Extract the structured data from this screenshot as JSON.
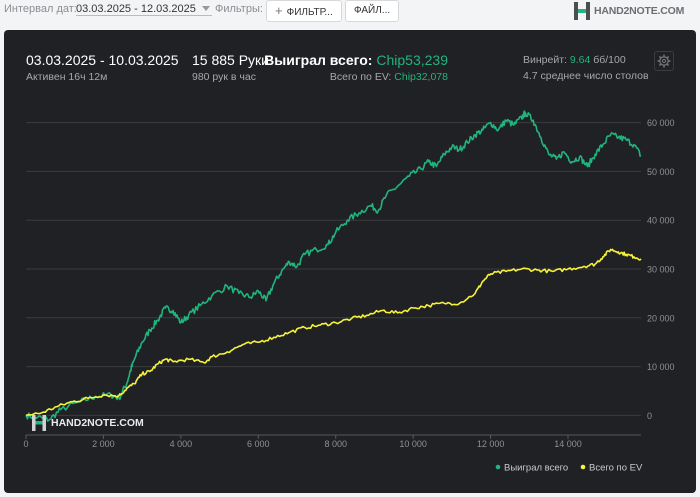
{
  "toolbar": {
    "interval_label": "Интервал дат:",
    "interval_value": "03.03.2025 - 12.03.2025",
    "filters_label": "Фильтры:",
    "filters_button": "ФИЛЬТР...",
    "files_button": "ФАЙЛ...",
    "logo_text": "HAND2NOTE.COM",
    "icons": {
      "add": "plus-icon",
      "dropdown": "chevron-down-icon",
      "settings": "gear-icon"
    }
  },
  "summary": {
    "date_range": "03.03.2025 - 10.03.2025",
    "active": "Активен 16ч 12м",
    "hands": "15 885 Руки",
    "hands_per_hour": "980 рук в час",
    "won_label": "Выиграл всего:",
    "won_value": "Chip53,239",
    "ev_label": "Всего по EV:",
    "ev_value": "Chip32,078",
    "winrate_label": "Винрейт:",
    "winrate_value": "9.64",
    "winrate_unit": "бб/100",
    "tables": "4.7 среднее число столов"
  },
  "watermark": "HAND2NOTE.COM",
  "colors": {
    "won": "#21b47d",
    "ev": "#f6f33a",
    "panel": "#202124",
    "grid": "#3a3c40"
  },
  "chart_data": {
    "type": "line",
    "xlim": [
      0,
      15885
    ],
    "ylim": [
      -3000,
      63000
    ],
    "x_ticks": [
      "0",
      "2 000",
      "4 000",
      "6 000",
      "8 000",
      "10 000",
      "12 000",
      "14 000"
    ],
    "y_ticks": [
      "0",
      "10 000",
      "20 000",
      "30 000",
      "40 000",
      "50 000",
      "60 000"
    ],
    "grid": true,
    "legend_position": "bottom-right",
    "series": [
      {
        "name": "Выиграл всего",
        "color": "#21b47d",
        "points": [
          [
            0,
            0
          ],
          [
            300,
            -400
          ],
          [
            600,
            -900
          ],
          [
            900,
            1200
          ],
          [
            1400,
            2800
          ],
          [
            1800,
            3900
          ],
          [
            2200,
            4200
          ],
          [
            2400,
            3500
          ],
          [
            2600,
            6500
          ],
          [
            2700,
            9200
          ],
          [
            2800,
            11500
          ],
          [
            3000,
            15000
          ],
          [
            3200,
            17500
          ],
          [
            3400,
            19500
          ],
          [
            3600,
            22000
          ],
          [
            3800,
            21500
          ],
          [
            4000,
            19000
          ],
          [
            4200,
            20500
          ],
          [
            4500,
            22500
          ],
          [
            4800,
            24500
          ],
          [
            5200,
            26500
          ],
          [
            5500,
            25000
          ],
          [
            5800,
            24200
          ],
          [
            6000,
            25500
          ],
          [
            6200,
            23500
          ],
          [
            6400,
            27000
          ],
          [
            6600,
            29500
          ],
          [
            6800,
            31500
          ],
          [
            7000,
            30500
          ],
          [
            7200,
            33000
          ],
          [
            7500,
            34000
          ],
          [
            7800,
            35000
          ],
          [
            8000,
            37500
          ],
          [
            8300,
            40000
          ],
          [
            8600,
            41500
          ],
          [
            8900,
            43000
          ],
          [
            9100,
            42000
          ],
          [
            9300,
            45000
          ],
          [
            9600,
            47000
          ],
          [
            9900,
            49000
          ],
          [
            10200,
            50500
          ],
          [
            10400,
            52000
          ],
          [
            10600,
            51000
          ],
          [
            10800,
            53500
          ],
          [
            11000,
            55000
          ],
          [
            11200,
            54500
          ],
          [
            11400,
            56000
          ],
          [
            11600,
            57500
          ],
          [
            11800,
            58500
          ],
          [
            12000,
            60000
          ],
          [
            12200,
            58500
          ],
          [
            12400,
            60500
          ],
          [
            12600,
            59500
          ],
          [
            12800,
            61000
          ],
          [
            12900,
            62000
          ],
          [
            13100,
            60500
          ],
          [
            13300,
            57000
          ],
          [
            13500,
            53500
          ],
          [
            13700,
            52500
          ],
          [
            13900,
            54000
          ],
          [
            14100,
            52000
          ],
          [
            14300,
            53000
          ],
          [
            14500,
            51000
          ],
          [
            14700,
            53500
          ],
          [
            14900,
            55500
          ],
          [
            15100,
            57500
          ],
          [
            15300,
            57000
          ],
          [
            15500,
            56500
          ],
          [
            15700,
            55500
          ],
          [
            15885,
            53239
          ]
        ]
      },
      {
        "name": "Всего по EV",
        "color": "#f6f33a",
        "points": [
          [
            0,
            0
          ],
          [
            400,
            500
          ],
          [
            800,
            1800
          ],
          [
            1200,
            2800
          ],
          [
            1600,
            3500
          ],
          [
            2000,
            4200
          ],
          [
            2400,
            4000
          ],
          [
            2600,
            5500
          ],
          [
            2800,
            6500
          ],
          [
            3000,
            8500
          ],
          [
            3200,
            9000
          ],
          [
            3400,
            10500
          ],
          [
            3600,
            11500
          ],
          [
            3800,
            11000
          ],
          [
            4200,
            11500
          ],
          [
            4600,
            10800
          ],
          [
            4800,
            12000
          ],
          [
            5200,
            13000
          ],
          [
            5600,
            14500
          ],
          [
            6000,
            15000
          ],
          [
            6400,
            16000
          ],
          [
            6800,
            17000
          ],
          [
            7200,
            18000
          ],
          [
            7600,
            18500
          ],
          [
            8000,
            19000
          ],
          [
            8400,
            19800
          ],
          [
            8800,
            20500
          ],
          [
            9200,
            21500
          ],
          [
            9600,
            21000
          ],
          [
            10000,
            22000
          ],
          [
            10400,
            22500
          ],
          [
            10800,
            23000
          ],
          [
            11200,
            23000
          ],
          [
            11600,
            25000
          ],
          [
            11800,
            27500
          ],
          [
            12000,
            29000
          ],
          [
            12400,
            29500
          ],
          [
            12800,
            30000
          ],
          [
            13200,
            29800
          ],
          [
            13600,
            29500
          ],
          [
            14000,
            30000
          ],
          [
            14400,
            30500
          ],
          [
            14700,
            31000
          ],
          [
            14900,
            32500
          ],
          [
            15100,
            34000
          ],
          [
            15300,
            33500
          ],
          [
            15500,
            33000
          ],
          [
            15700,
            32500
          ],
          [
            15885,
            32078
          ]
        ]
      }
    ]
  }
}
